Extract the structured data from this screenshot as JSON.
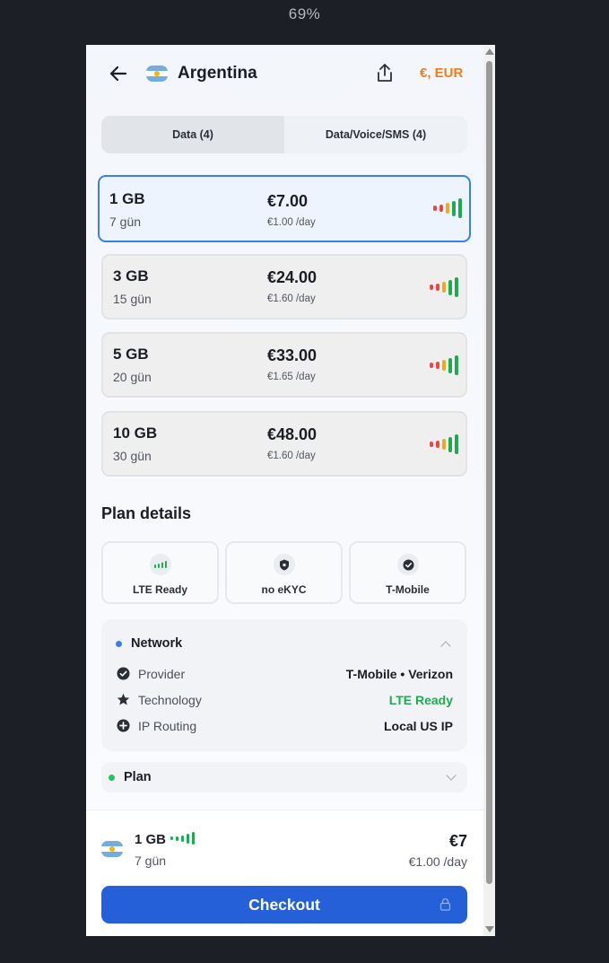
{
  "browser": {
    "zoom_label": "69%"
  },
  "header": {
    "country": "Argentina",
    "currency": "€, EUR"
  },
  "tabs": [
    {
      "label": "Data (4)",
      "active": true
    },
    {
      "label": "Data/Voice/SMS (4)",
      "active": false
    }
  ],
  "plans": [
    {
      "size": "1 GB",
      "days": "7 gün",
      "price": "€7.00",
      "per_day": "€1.00 /day",
      "selected": true
    },
    {
      "size": "3 GB",
      "days": "15 gün",
      "price": "€24.00",
      "per_day": "€1.60 /day",
      "selected": false
    },
    {
      "size": "5 GB",
      "days": "20 gün",
      "price": "€33.00",
      "per_day": "€1.65 /day",
      "selected": false
    },
    {
      "size": "10 GB",
      "days": "30 gün",
      "price": "€48.00",
      "per_day": "€1.60 /day",
      "selected": false
    }
  ],
  "plan_details": {
    "title": "Plan details",
    "features": [
      {
        "label": "LTE Ready",
        "icon": "signal-icon"
      },
      {
        "label": "no eKYC",
        "icon": "shield-icon"
      },
      {
        "label": "T-Mobile",
        "icon": "check-circle-icon"
      }
    ]
  },
  "network": {
    "title": "Network",
    "rows": [
      {
        "icon": "check-circle-icon",
        "label": "Provider",
        "value": "T-Mobile • Verizon"
      },
      {
        "icon": "star-icon",
        "label": "Technology",
        "value": "LTE Ready"
      },
      {
        "icon": "plus-circle-icon",
        "label": "IP Routing",
        "value": "Local US IP"
      }
    ]
  },
  "plan_section": {
    "title": "Plan"
  },
  "summary": {
    "size": "1 GB",
    "days": "7 gün",
    "price": "€7",
    "per_day": "€1.00 /day"
  },
  "checkout": {
    "label": "Checkout"
  },
  "colors": {
    "accent": "#2660d8",
    "selected_border": "#3b7fe6",
    "currency": "#f07c1b",
    "lte_green": "#22a852",
    "network_dot": "#3b7fe6",
    "plan_dot": "#22c55e",
    "signal": [
      "#ef4444",
      "#ef4444",
      "#f5a623",
      "#22a852",
      "#22a852"
    ]
  }
}
